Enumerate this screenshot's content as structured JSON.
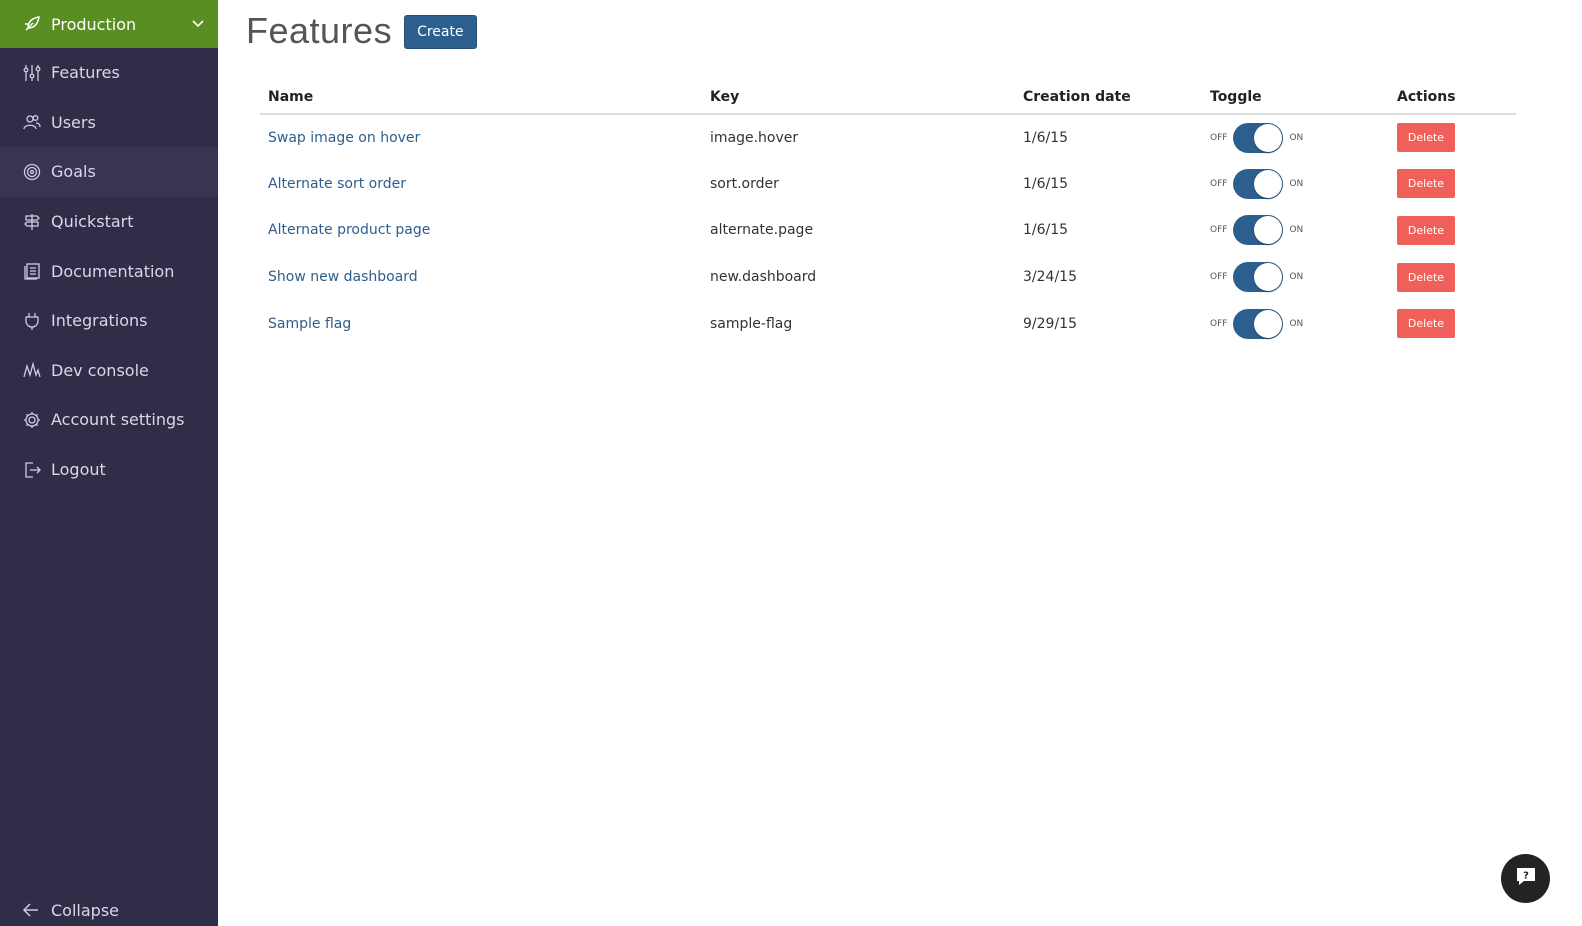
{
  "sidebar": {
    "environment": {
      "label": "Production",
      "icon": "feather-icon"
    },
    "items": [
      {
        "label": "Features",
        "icon": "sliders-icon",
        "active": false
      },
      {
        "label": "Users",
        "icon": "users-icon",
        "active": false
      },
      {
        "label": "Goals",
        "icon": "target-icon",
        "active": true
      },
      {
        "label": "Quickstart",
        "icon": "signpost-icon",
        "active": false
      },
      {
        "label": "Documentation",
        "icon": "book-icon",
        "active": false
      },
      {
        "label": "Integrations",
        "icon": "plug-icon",
        "active": false
      },
      {
        "label": "Dev console",
        "icon": "waveform-icon",
        "active": false
      },
      {
        "label": "Account settings",
        "icon": "gear-icon",
        "active": false
      },
      {
        "label": "Logout",
        "icon": "logout-icon",
        "active": false
      }
    ],
    "collapse_label": "Collapse"
  },
  "header": {
    "title": "Features",
    "create_label": "Create"
  },
  "table": {
    "columns": [
      "Name",
      "Key",
      "Creation date",
      "Toggle",
      "Actions"
    ],
    "toggle_off_label": "OFF",
    "toggle_on_label": "ON",
    "delete_label": "Delete",
    "rows": [
      {
        "name": "Swap image on hover",
        "key": "image.hover",
        "date": "1/6/15",
        "on": true
      },
      {
        "name": "Alternate sort order",
        "key": "sort.order",
        "date": "1/6/15",
        "on": true
      },
      {
        "name": "Alternate product page",
        "key": "alternate.page",
        "date": "1/6/15",
        "on": true
      },
      {
        "name": "Show new dashboard",
        "key": "new.dashboard",
        "date": "3/24/15",
        "on": true
      },
      {
        "name": "Sample flag",
        "key": "sample-flag",
        "date": "9/29/15",
        "on": true
      }
    ]
  },
  "colors": {
    "sidebar_bg": "#302d48",
    "env_bg": "#5a8e22",
    "primary": "#2c5f8e",
    "danger": "#f0605a"
  }
}
